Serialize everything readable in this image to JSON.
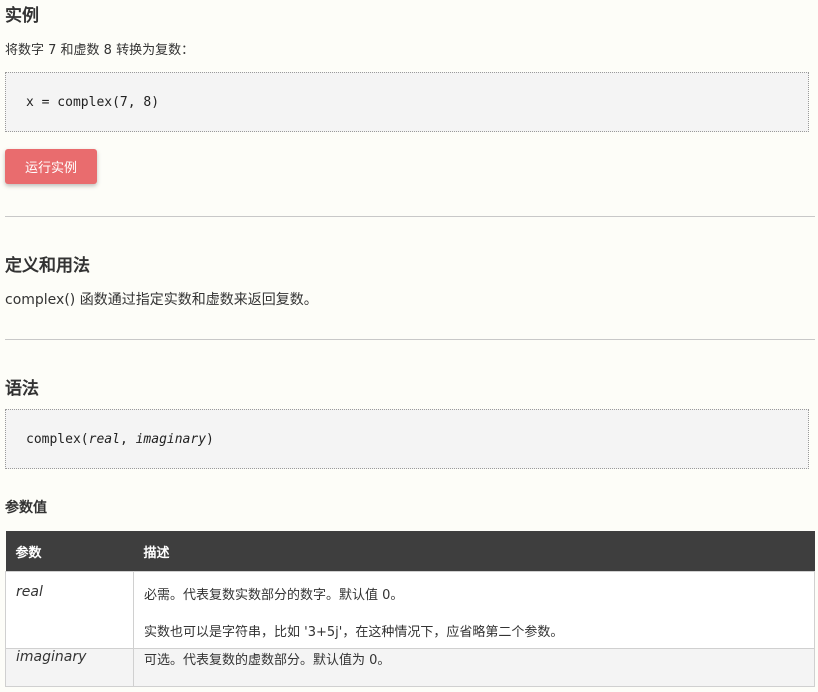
{
  "example": {
    "heading": "实例",
    "intro": "将数字 7 和虚数 8 转换为复数：",
    "code": "x = complex(7, 8)",
    "run_button": "运行实例"
  },
  "definition": {
    "heading": "定义和用法",
    "text": "complex() 函数通过指定实数和虚数来返回复数。"
  },
  "syntax": {
    "heading": "语法",
    "code_prefix": "complex(",
    "param1": "real",
    "separator": ", ",
    "param2": "imaginary",
    "code_suffix": ")"
  },
  "params": {
    "heading": "参数值",
    "columns": [
      "参数",
      "描述"
    ],
    "rows": [
      {
        "name": "real",
        "desc": [
          "必需。代表复数实数部分的数字。默认值 0。",
          "实数也可以是字符串，比如 '3+5j'，在这种情况下，应省略第二个参数。"
        ]
      },
      {
        "name": "imaginary",
        "desc": [
          "可选。代表复数的虚数部分。默认值为 0。"
        ]
      }
    ]
  },
  "colors": {
    "run_button_bg": "#e96c6e",
    "table_header_bg": "#3e3e3e",
    "page_bg": "#fdfdf8"
  }
}
